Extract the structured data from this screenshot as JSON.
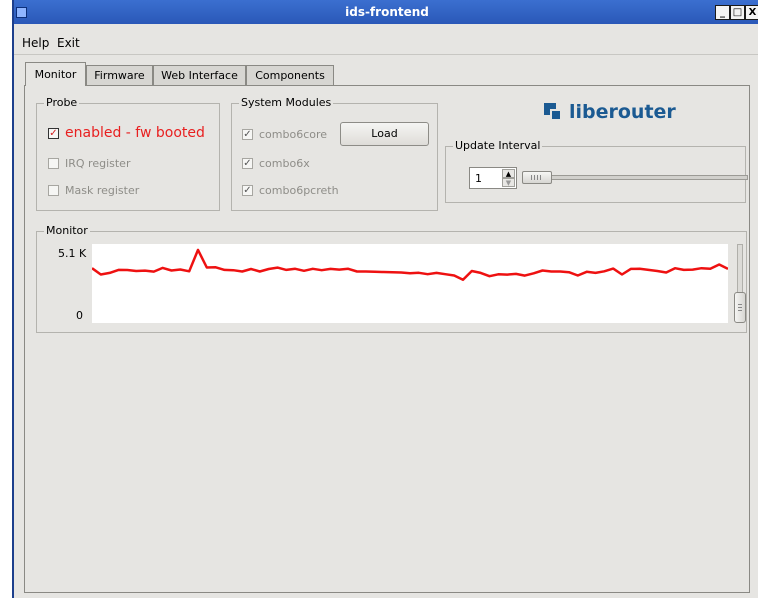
{
  "window": {
    "title": "ids-frontend",
    "controls": {
      "minimize": "_",
      "maximize": "□",
      "close": "X"
    }
  },
  "menu": {
    "items": [
      "Help",
      "Exit"
    ]
  },
  "tabs": [
    "Monitor",
    "Firmware",
    "Web Interface",
    "Components"
  ],
  "active_tab": "Monitor",
  "probe": {
    "title": "Probe",
    "items": [
      {
        "label": "enabled - fw booted",
        "checked": true
      },
      {
        "label": "IRQ register",
        "checked": false
      },
      {
        "label": "Mask register",
        "checked": false
      }
    ]
  },
  "system_modules": {
    "title": "System Modules",
    "items": [
      {
        "label": "combo6core",
        "checked": true
      },
      {
        "label": "combo6x",
        "checked": true
      },
      {
        "label": "combo6pcreth",
        "checked": true
      }
    ],
    "load_label": "Load"
  },
  "logo": {
    "text": "liberouter",
    "color": "#1b5a92"
  },
  "update_interval": {
    "title": "Update Interval",
    "value": "1",
    "slider_fraction": 0.0
  },
  "monitor": {
    "title": "Monitor"
  },
  "chart_data": {
    "type": "line",
    "y_tick_labels": [
      "5.1 K",
      "0"
    ],
    "ylim": [
      0,
      5100
    ],
    "grid": false,
    "series": [
      {
        "color": "#ee1111",
        "values": [
          3620,
          3180,
          3290,
          3500,
          3490,
          3420,
          3450,
          3380,
          3640,
          3460,
          3530,
          3400,
          4900,
          3670,
          3680,
          3500,
          3480,
          3390,
          3560,
          3390,
          3560,
          3660,
          3500,
          3580,
          3440,
          3580,
          3480,
          3570,
          3520,
          3580,
          3390,
          3390,
          3370,
          3350,
          3330,
          3320,
          3270,
          3300,
          3200,
          3290,
          3200,
          3110,
          2810,
          3420,
          3290,
          3060,
          3190,
          3170,
          3220,
          3100,
          3260,
          3460,
          3390,
          3390,
          3340,
          3110,
          3370,
          3290,
          3400,
          3590,
          3180,
          3570,
          3580,
          3500,
          3420,
          3320,
          3620,
          3500,
          3520,
          3620,
          3580,
          3880,
          3570
        ]
      }
    ]
  },
  "colors": {
    "line": "#ee1111",
    "titlebar": "#2f62c4",
    "accent_red": "#e82020"
  }
}
